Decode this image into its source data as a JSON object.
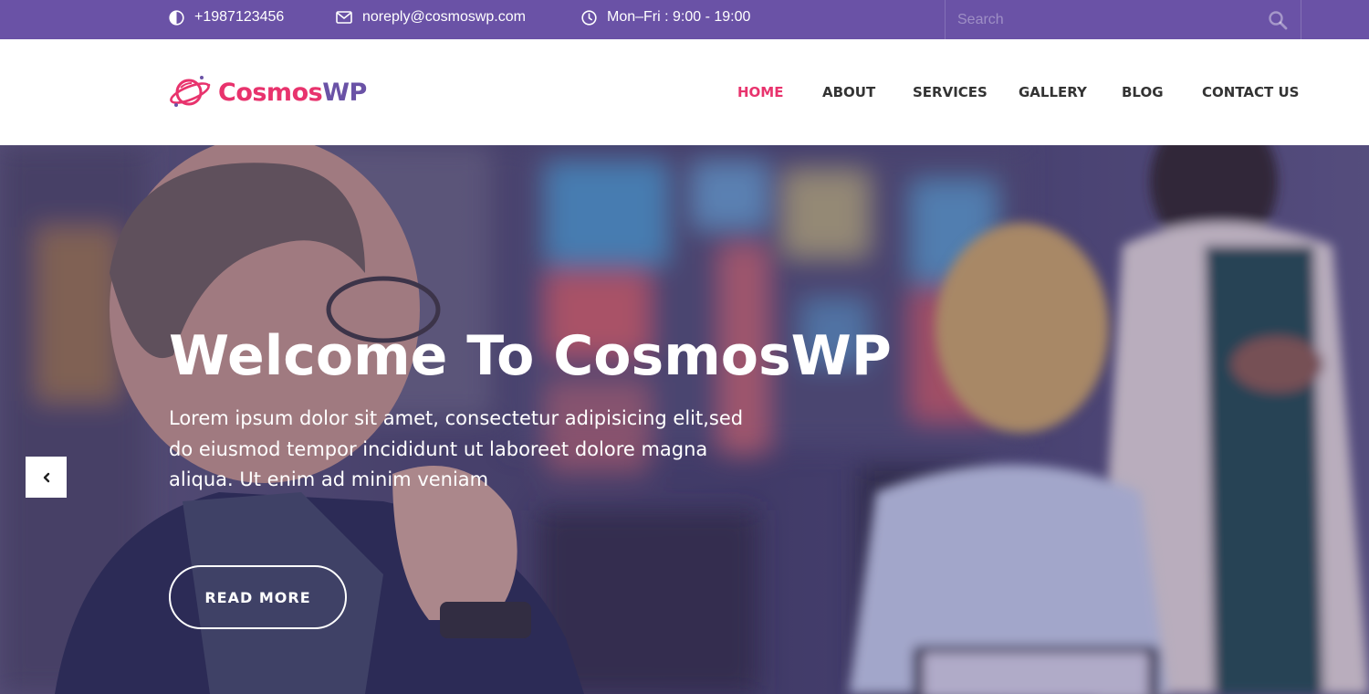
{
  "topbar": {
    "phone": "+1987123456",
    "email": "noreply@cosmoswp.com",
    "hours": "Mon–Fri : 9:00 - 19:00",
    "search_placeholder": "Search"
  },
  "header": {
    "logo_part1": "Cosmos",
    "logo_part2": "WP",
    "nav": [
      {
        "label": "HOME",
        "active": true
      },
      {
        "label": "ABOUT"
      },
      {
        "label": "SERVICES"
      },
      {
        "label": "GALLERY"
      },
      {
        "label": "BLOG"
      },
      {
        "label": "CONTACT US"
      }
    ]
  },
  "hero": {
    "title": "Welcome To CosmosWP",
    "text": "Lorem ipsum dolor sit amet, consectetur adipisicing elit,sed do eiusmod tempor incididunt ut laboreet dolore magna aliqua. Ut enim ad minim veniam",
    "button_label": "READ MORE"
  },
  "colors": {
    "topbar": "#6a52a6",
    "accent_pink": "#e8336d",
    "accent_purple": "#6a52a6",
    "nav_text": "#333333"
  },
  "icons": {
    "phone": "contrast-circle-icon",
    "email": "envelope-icon",
    "hours": "clock-icon",
    "search": "search-icon",
    "prev": "chevron-left-icon",
    "logo": "planet-icon"
  }
}
